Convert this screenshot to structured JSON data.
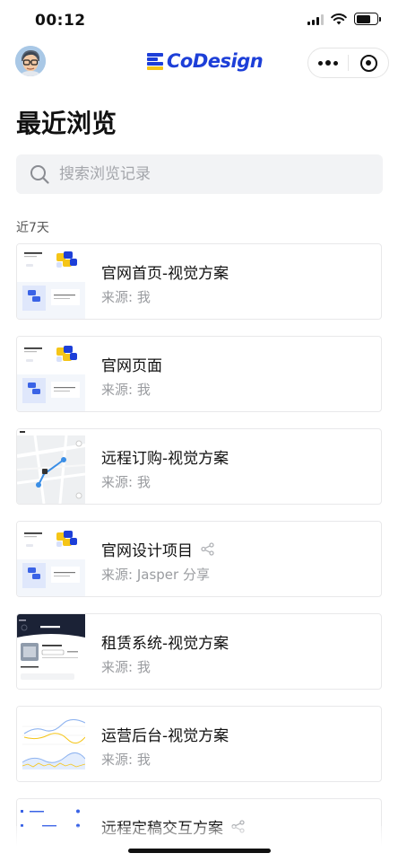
{
  "status_bar": {
    "time": "00:12"
  },
  "header": {
    "logo_text": "CoDesign",
    "more_icon": "more-dots-icon",
    "close_icon": "target-close-icon"
  },
  "page": {
    "title": "最近浏览",
    "search_placeholder": "搜索浏览记录",
    "section_label": "近7天"
  },
  "items": [
    {
      "title": "官网首页-视觉方案",
      "source": "来源: 我",
      "shared": false,
      "thumb": "website"
    },
    {
      "title": "官网页面",
      "source": "来源: 我",
      "shared": false,
      "thumb": "website"
    },
    {
      "title": "远程订购-视觉方案",
      "source": "来源: 我",
      "shared": false,
      "thumb": "map"
    },
    {
      "title": "官网设计项目",
      "source": "来源: Jasper 分享",
      "shared": true,
      "thumb": "website"
    },
    {
      "title": "租赁系统-视觉方案",
      "source": "来源: 我",
      "shared": false,
      "thumb": "booking"
    },
    {
      "title": "运营后台-视觉方案",
      "source": "来源: 我",
      "shared": false,
      "thumb": "chart"
    },
    {
      "title": "远程定稿交互方案",
      "source": "",
      "shared": true,
      "thumb": "list"
    }
  ],
  "colors": {
    "brand_blue": "#1d3fd8",
    "brand_yellow": "#f5c518",
    "muted_text": "#9a9ca0",
    "search_bg": "#f2f3f5"
  }
}
